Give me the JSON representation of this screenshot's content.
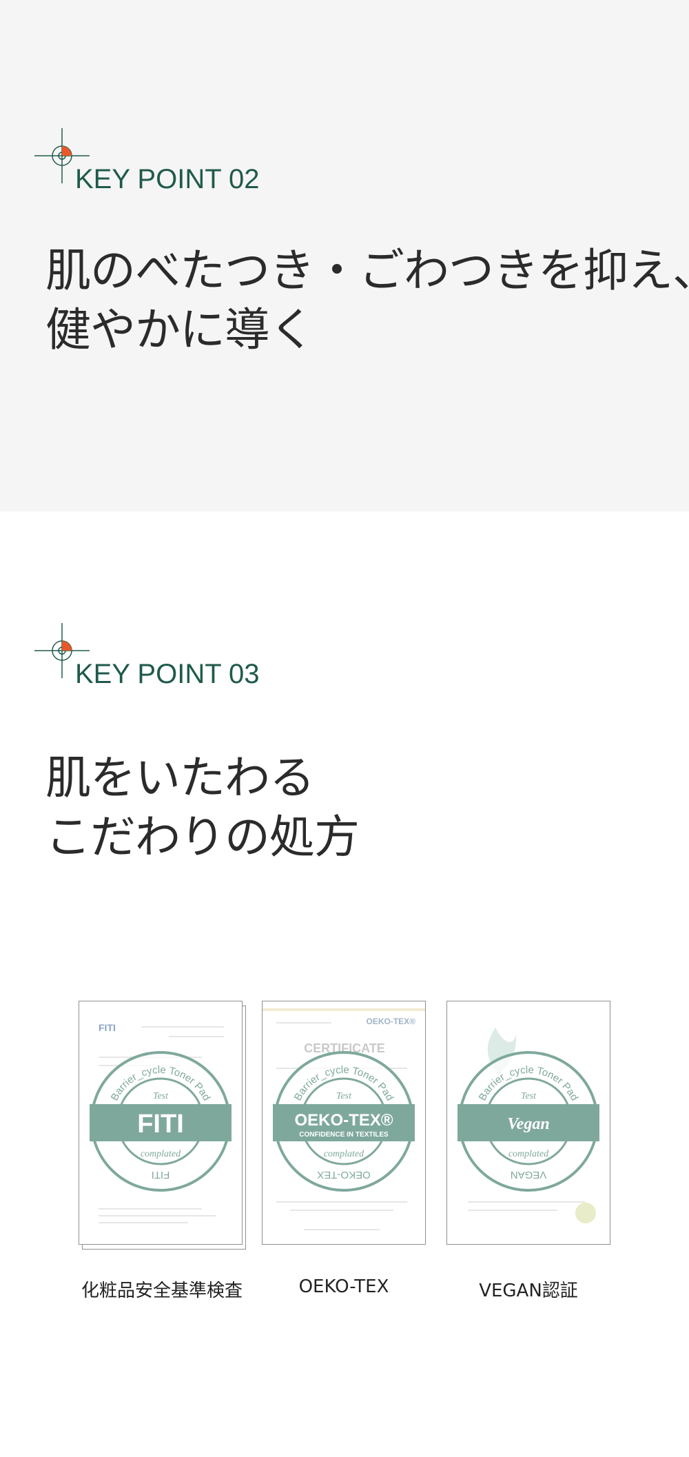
{
  "key_point_2": {
    "label": "KEY POINT 02",
    "headline": [
      "肌のべたつき・ごわつきを抑え、",
      "健やかに導く"
    ]
  },
  "key_point_3": {
    "label": "KEY POINT 03",
    "headline": [
      "肌をいたわる",
      "こだわりの処方"
    ]
  },
  "certificates": [
    {
      "label": "化粧品安全基準検査",
      "badge_ring_text": "Barrier_cycle Toner Pad",
      "badge_top": "Test",
      "badge_band": "FITI",
      "badge_bottom": "complated",
      "badge_footer": "FITI",
      "doc_logo": "FITI"
    },
    {
      "label": "OEKO-TEX",
      "badge_ring_text": "Barrier_cycle Toner Pad",
      "badge_top": "Test",
      "badge_band": "OEKO-TEX®",
      "badge_band_sub": "CONFIDENCE IN TEXTILES",
      "badge_bottom": "complated",
      "badge_footer": "OEKO-TEX",
      "doc_logo": "OEKO-TEX®",
      "doc_title": "CERTIFICATE"
    },
    {
      "label": "VEGAN認証",
      "badge_ring_text": "Barrier_cycle Toner Pad",
      "badge_top": "Test",
      "badge_band": "Vegan",
      "badge_bottom": "complated",
      "badge_footer": "VEGAN"
    }
  ],
  "colors": {
    "accent_green": "#1f5a4b",
    "accent_orange": "#e8582a",
    "badge_teal": "#7fa89d",
    "gray_background": "#f5f5f5"
  }
}
